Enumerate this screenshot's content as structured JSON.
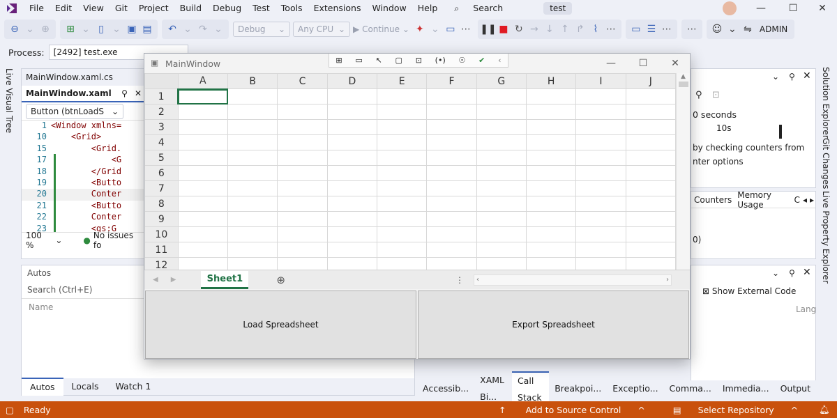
{
  "menu": {
    "items": [
      "File",
      "Edit",
      "View",
      "Git",
      "Project",
      "Build",
      "Debug",
      "Test",
      "Tools",
      "Extensions",
      "Window",
      "Help"
    ],
    "search_label": "Search",
    "solution_name": "test"
  },
  "toolbar": {
    "config": "Debug",
    "platform": "Any CPU",
    "continue_label": "Continue",
    "user": "ADMIN"
  },
  "process": {
    "label": "Process:",
    "value": "[2492] test.exe"
  },
  "side_tabs": {
    "left": "Live Visual Tree",
    "right_1": "Solution Explorer",
    "right_2": "Git Changes",
    "right_3": "Live Property Explorer"
  },
  "editor": {
    "inactive_tab": "MainWindow.xaml.cs",
    "active_tab": "MainWindow.xaml",
    "element_combo": "Button (btnLoadS",
    "lines": [
      {
        "n": "1",
        "code": "<Window xmlns="
      },
      {
        "n": "10",
        "code": "    <Grid>"
      },
      {
        "n": "15",
        "code": "        <Grid."
      },
      {
        "n": "17",
        "code": "            <G"
      },
      {
        "n": "18",
        "code": "        </Grid"
      },
      {
        "n": "19",
        "code": "        <Butto"
      },
      {
        "n": "20",
        "code": "        Conter"
      },
      {
        "n": "21",
        "code": "        <Butto"
      },
      {
        "n": "22",
        "code": "        Conter"
      },
      {
        "n": "23",
        "code": "        <gs:G"
      }
    ],
    "zoom": "100 %",
    "issues": "No issues fo"
  },
  "autos": {
    "title": "Autos",
    "search_placeholder": "Search (Ctrl+E)",
    "column_name": "Name",
    "tabs": [
      "Autos",
      "Locals",
      "Watch 1"
    ]
  },
  "right_panel": {
    "seconds_label": "0 seconds",
    "timeline_tick": "10s",
    "info_line1": "by checking counters from",
    "info_line2": "nter options",
    "tabs": [
      "Counters",
      "Memory Usage",
      "C"
    ],
    "mid_value": "0)",
    "show_external": "Show External Code",
    "lang_header": "Lang"
  },
  "bottom_right_tabs": [
    "Accessib...",
    "XAML Bi...",
    "Call Stack",
    "Breakpoi...",
    "Exceptio...",
    "Comma...",
    "Immedia...",
    "Output"
  ],
  "status": {
    "ready": "Ready",
    "source_control": "Add to Source Control",
    "repository": "Select Repository"
  },
  "app_window": {
    "title": "MainWindow",
    "columns": [
      "A",
      "B",
      "C",
      "D",
      "E",
      "F",
      "G",
      "H",
      "I",
      "J"
    ],
    "rows": [
      "1",
      "2",
      "3",
      "4",
      "5",
      "6",
      "7",
      "8",
      "9",
      "10",
      "11",
      "12"
    ],
    "sheet_tab": "Sheet1",
    "load_button": "Load Spreadsheet",
    "export_button": "Export Spreadsheet"
  },
  "colors": {
    "status_bar": "#c9510c",
    "accent": "#3a64b8",
    "sheet_green": "#217346"
  }
}
